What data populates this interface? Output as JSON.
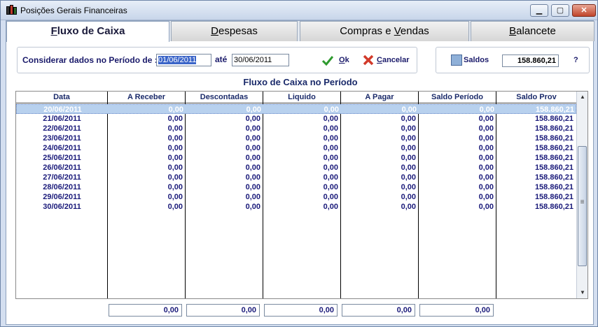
{
  "window": {
    "title": "Posições Gerais Financeiras"
  },
  "titlebar": {
    "min": "▁",
    "max": "▢",
    "close": "✕"
  },
  "tabs": [
    {
      "label": "Fluxo de Caixa",
      "key": "F",
      "rest": "luxo de Caixa"
    },
    {
      "label": "Despesas",
      "key": "D",
      "rest": "espesas"
    },
    {
      "label": "Compras e Vendas",
      "pre": "Compras e ",
      "key": "V",
      "rest": "endas"
    },
    {
      "label": "Balancete",
      "key": "B",
      "rest": "alancete"
    }
  ],
  "filter": {
    "label": "Considerar dados no Período de :",
    "start": "01/06/2011",
    "ate": "até",
    "end": "30/06/2011",
    "ok_key": "O",
    "ok_rest": "k",
    "cancel_key": "C",
    "cancel_rest": "ancelar"
  },
  "saldos": {
    "label": "Saldos",
    "value": "158.860,21",
    "help": "?"
  },
  "section_title": "Fluxo de Caixa no Período",
  "grid": {
    "columns": [
      "Data",
      "A Receber",
      "Descontadas",
      "Liquido",
      "A Pagar",
      "Saldo Período",
      "Saldo Prov"
    ],
    "rows": [
      [
        "20/06/2011",
        "0,00",
        "0,00",
        "0,00",
        "0,00",
        "0,00",
        "158.860,21"
      ],
      [
        "21/06/2011",
        "0,00",
        "0,00",
        "0,00",
        "0,00",
        "0,00",
        "158.860,21"
      ],
      [
        "22/06/2011",
        "0,00",
        "0,00",
        "0,00",
        "0,00",
        "0,00",
        "158.860,21"
      ],
      [
        "23/06/2011",
        "0,00",
        "0,00",
        "0,00",
        "0,00",
        "0,00",
        "158.860,21"
      ],
      [
        "24/06/2011",
        "0,00",
        "0,00",
        "0,00",
        "0,00",
        "0,00",
        "158.860,21"
      ],
      [
        "25/06/2011",
        "0,00",
        "0,00",
        "0,00",
        "0,00",
        "0,00",
        "158.860,21"
      ],
      [
        "26/06/2011",
        "0,00",
        "0,00",
        "0,00",
        "0,00",
        "0,00",
        "158.860,21"
      ],
      [
        "27/06/2011",
        "0,00",
        "0,00",
        "0,00",
        "0,00",
        "0,00",
        "158.860,21"
      ],
      [
        "28/06/2011",
        "0,00",
        "0,00",
        "0,00",
        "0,00",
        "0,00",
        "158.860,21"
      ],
      [
        "29/06/2011",
        "0,00",
        "0,00",
        "0,00",
        "0,00",
        "0,00",
        "158.860,21"
      ],
      [
        "30/06/2011",
        "0,00",
        "0,00",
        "0,00",
        "0,00",
        "0,00",
        "158.860,21"
      ]
    ],
    "scroll_up": "▲",
    "scroll_down": "▼",
    "thumb_grip": "≡"
  },
  "totals": [
    "0,00",
    "0,00",
    "0,00",
    "0,00",
    "0,00"
  ],
  "colors": {
    "accent": "#1a1a7a",
    "selection": "#b8d1ee",
    "field_selection": "#3a64c8"
  },
  "icons": {
    "ok": "check-icon",
    "cancel": "x-icon",
    "saldos": "saldos-icon",
    "app": "books-icon"
  }
}
